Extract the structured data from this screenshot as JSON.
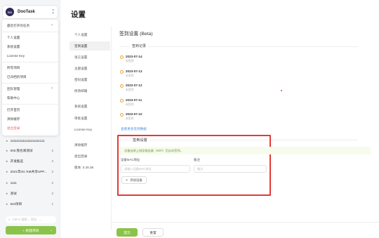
{
  "app": {
    "name": "DooTask",
    "logo_text": "DO"
  },
  "dropdown_menu": [
    {
      "label": "最近打开的任务",
      "has_arrow": true
    },
    {
      "label": "个人设置"
    },
    {
      "label": "系统设置"
    },
    {
      "label": "License Key"
    },
    {
      "label": "所有项目"
    },
    {
      "label": "已归档的项目"
    },
    {
      "label": "团队管理",
      "has_arrow": true
    },
    {
      "label": "帮助中心"
    },
    {
      "label": "打开首页"
    },
    {
      "label": "清除缓存"
    },
    {
      "label": "退出登录",
      "danger": true
    }
  ],
  "projects": [
    {
      "label": "1111111111111111111111",
      "count": ""
    },
    {
      "label": "000.我也来测试",
      "count": "2"
    },
    {
      "label": "开发甄选",
      "count": "3"
    },
    {
      "label": "2021年0G.ToB共享UPP...",
      "count": "2"
    },
    {
      "label": "1111",
      "count": "2"
    },
    {
      "label": "测试",
      "count": "2"
    },
    {
      "label": "test项目",
      "count": "1"
    }
  ],
  "sidebar_search": {
    "placeholder": "Ctrl+F 搜索... 项目、..."
  },
  "new_project_label": "+ 新建项目",
  "page": {
    "title": "设置"
  },
  "settings_nav": [
    {
      "label": "个人设置",
      "active": false
    },
    {
      "label": "签到设置",
      "active": true
    },
    {
      "label": "语言设置",
      "active": false
    },
    {
      "label": "主题设置",
      "active": false
    },
    {
      "label": "密码设置",
      "active": false
    },
    {
      "label": "修改邮箱",
      "active": false
    },
    {
      "label": "系统设置",
      "active": false
    },
    {
      "label": "审批设置",
      "active": false
    },
    {
      "label": "License Key",
      "active": false
    },
    {
      "label": "清除缓存",
      "active": false
    },
    {
      "label": "退出登录",
      "active": false
    },
    {
      "label": "版本: 0.28.38",
      "active": false
    }
  ],
  "section": {
    "title": "签到设置 (Beta)"
  },
  "records": {
    "label": "签到记录",
    "entries": [
      {
        "date": "2023-07-14",
        "status": "未签到"
      },
      {
        "date": "2023-07-13",
        "status": "未签到"
      },
      {
        "date": "2023-07-12",
        "status": "未签到"
      },
      {
        "date": "2023-07-11",
        "status": "未签到"
      },
      {
        "date": "2023-07-10",
        "status": "未签到"
      }
    ],
    "more_link": "查看更多签到数据"
  },
  "checkin_settings": {
    "label": "签到设置",
    "hint": "设备连接上指定路由器（WiFi）后自动签到。",
    "mac_label": "设备MAC地址",
    "mac_placeholder": "请输入设备MAC地址",
    "note_label": "备注",
    "note_placeholder": "备注",
    "add_button": "添加设备",
    "add_icon": "+"
  },
  "footer": {
    "submit": "提交",
    "reset": "重置"
  },
  "colors": {
    "accent_green": "#8bc34a",
    "highlight_red": "#e53935",
    "dot_orange": "#f0a030",
    "link_blue": "#4a90e2"
  }
}
